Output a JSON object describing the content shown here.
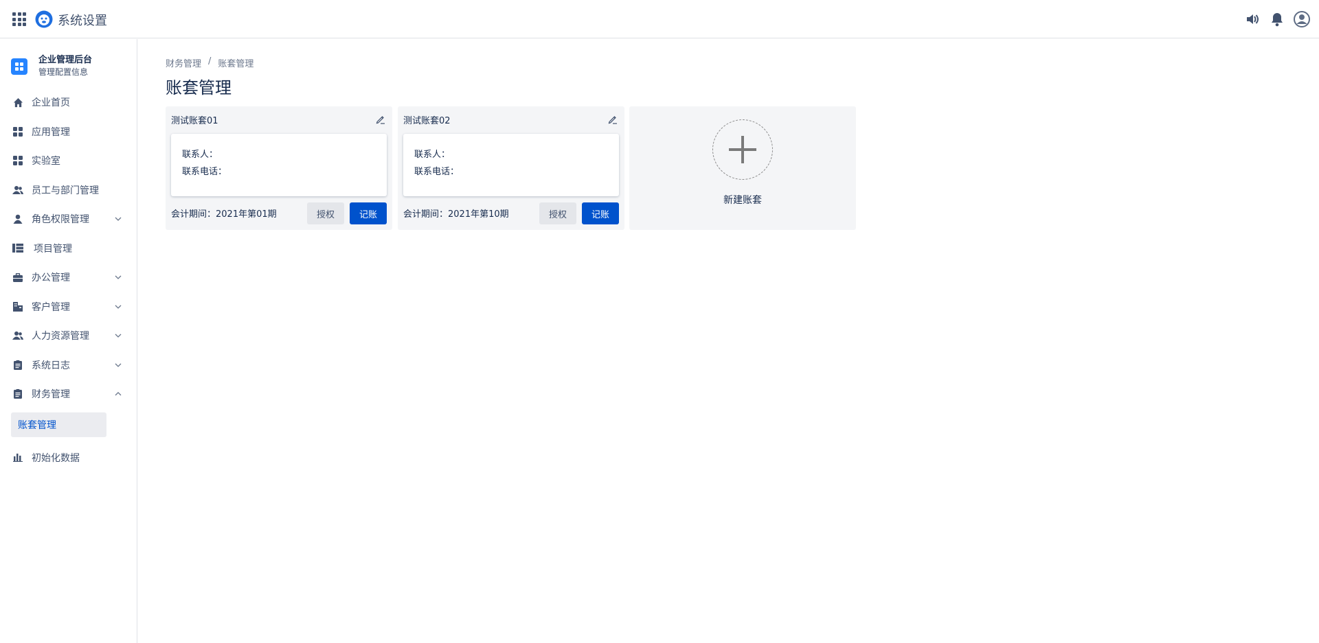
{
  "header": {
    "title": "系统设置",
    "icons": [
      "app-grid-icon",
      "monkey-logo-icon",
      "speaker-icon",
      "bell-icon",
      "user-avatar-icon"
    ]
  },
  "sidebar": {
    "org_name": "企业管理后台",
    "org_sub": "管理配置信息",
    "items": [
      {
        "label": "企业首页",
        "icon": "home-icon",
        "expandable": false
      },
      {
        "label": "应用管理",
        "icon": "apps-icon",
        "expandable": false
      },
      {
        "label": "实验室",
        "icon": "apps-icon",
        "expandable": false
      },
      {
        "label": "员工与部门管理",
        "icon": "people-icon",
        "expandable": false
      },
      {
        "label": "角色权限管理",
        "icon": "person-icon",
        "expandable": true,
        "expanded": false
      },
      {
        "label": "项目管理",
        "icon": "list-icon",
        "expandable": false
      },
      {
        "label": "办公管理",
        "icon": "briefcase-icon",
        "expandable": true,
        "expanded": false
      },
      {
        "label": "客户管理",
        "icon": "building-icon",
        "expandable": true,
        "expanded": false
      },
      {
        "label": "人力资源管理",
        "icon": "people-icon",
        "expandable": true,
        "expanded": false
      },
      {
        "label": "系统日志",
        "icon": "clipboard-icon",
        "expandable": true,
        "expanded": false
      },
      {
        "label": "财务管理",
        "icon": "clipboard-icon",
        "expandable": true,
        "expanded": true
      }
    ],
    "sub_item": "账套管理",
    "last_item": {
      "label": "初始化数据",
      "icon": "bar-chart-icon"
    }
  },
  "breadcrumb": {
    "parent": "财务管理",
    "separator": "/",
    "current": "账套管理"
  },
  "page_title": "账套管理",
  "cards": [
    {
      "title": "测试账套01",
      "contact_label": "联系人：",
      "phone_label": "联系电话：",
      "period": "会计期间：2021年第01期",
      "grant_label": "授权",
      "book_label": "记账"
    },
    {
      "title": "测试账套02",
      "contact_label": "联系人：",
      "phone_label": "联系电话：",
      "period": "会计期间：2021年第10期",
      "grant_label": "授权",
      "book_label": "记账"
    }
  ],
  "new_card": {
    "label": "新建账套"
  },
  "colors": {
    "primary": "#0052cc",
    "accent": "#2684ff",
    "text": "#172b4d",
    "muted": "#42526e",
    "card_bg": "#f4f5f7"
  }
}
